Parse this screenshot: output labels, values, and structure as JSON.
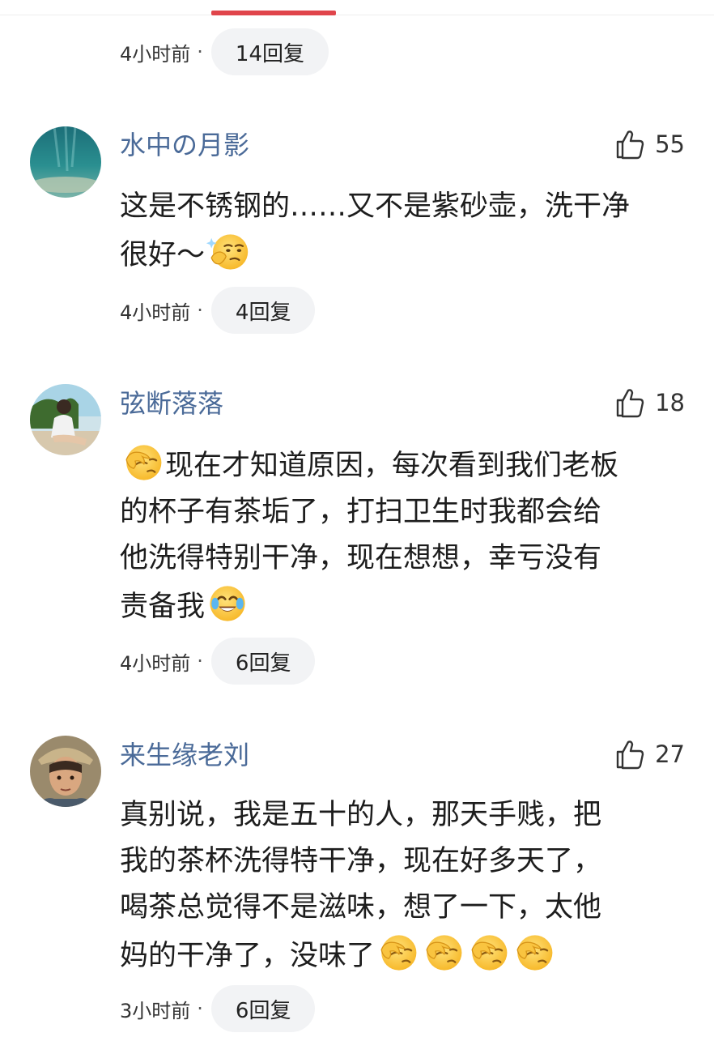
{
  "header": {
    "time": "4小时前",
    "separator": "·",
    "replies": "14回复"
  },
  "comments": [
    {
      "username": "水中の月影",
      "likes": "55",
      "text_parts": [
        "这是不锈钢的……又不是紫砂壶，洗干净",
        "很好～"
      ],
      "emojis": [
        "sly-thinking-emoji"
      ],
      "time": "4小时前",
      "separator": "·",
      "replies": "4回复"
    },
    {
      "username": "弦断落落",
      "likes": "18",
      "text_parts": [
        "现在才知道原因，每次看到我们老板",
        "的杯子有茶垢了，打扫卫生时我都会给",
        "他洗得特别干净，现在想想，幸亏没有",
        "责备我"
      ],
      "emojis": [
        "facepalm-emoji",
        "tears-of-joy-emoji"
      ],
      "time": "4小时前",
      "separator": "·",
      "replies": "6回复"
    },
    {
      "username": "来生缘老刘",
      "likes": "27",
      "text_parts": [
        "真别说，我是五十的人，那天手贱，把",
        "我的茶杯洗得特干净，现在好多天了，",
        "喝茶总觉得不是滋味，想了一下，太他",
        "妈的干净了，没味了"
      ],
      "emojis": [
        "facepalm-emoji",
        "facepalm-emoji",
        "facepalm-emoji",
        "facepalm-emoji"
      ],
      "time": "3小时前",
      "separator": "·",
      "replies": "6回复"
    }
  ],
  "colors": {
    "accent": "#e0454b",
    "username": "#4a6a98",
    "pill_bg": "#f2f3f5",
    "emoji_yellow": "#fcc63a"
  }
}
